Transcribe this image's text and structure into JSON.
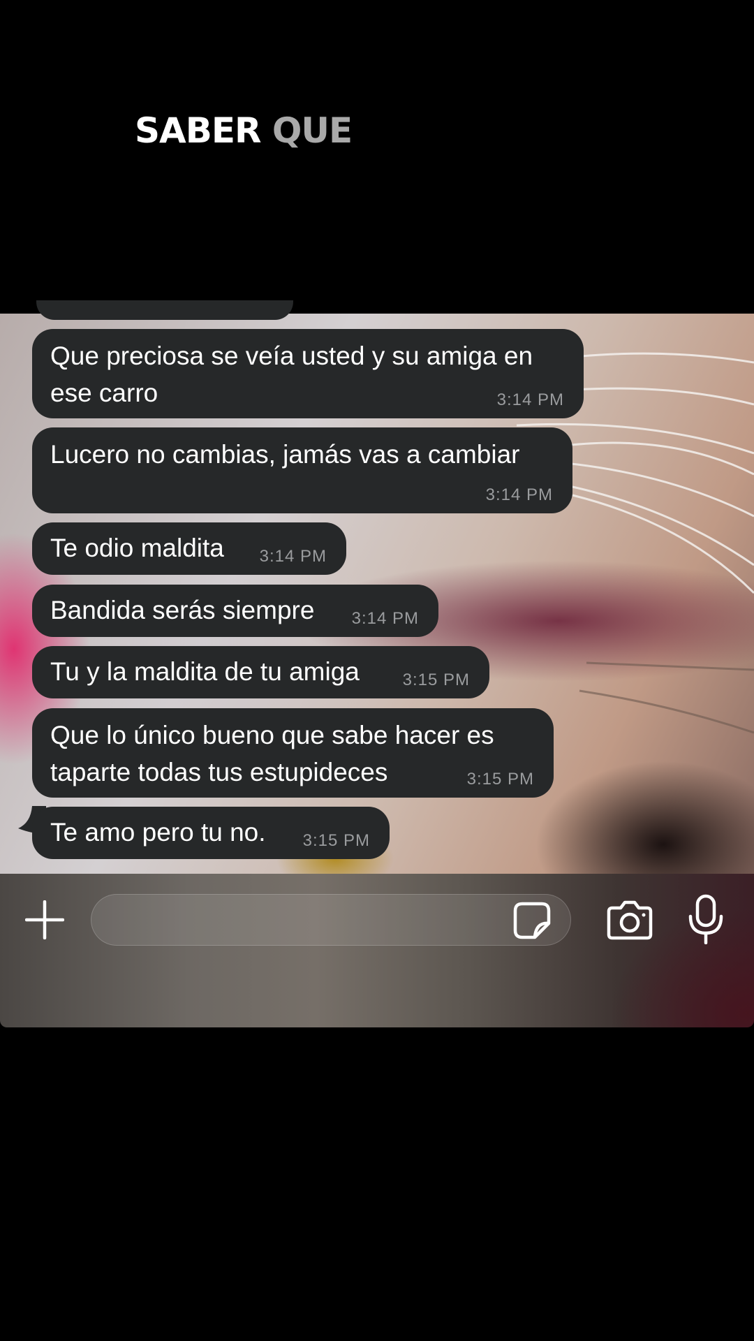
{
  "caption": {
    "part1": "SABER",
    "part2": "QUE"
  },
  "messages": [
    {
      "text": "Que preciosa se veía usted y su amiga en ese carro",
      "time": "3:14 PM"
    },
    {
      "text": "Lucero no cambias, jamás vas a cambiar",
      "time": "3:14 PM"
    },
    {
      "text": "Te odio maldita",
      "time": "3:14 PM"
    },
    {
      "text": "Bandida serás siempre",
      "time": "3:14 PM"
    },
    {
      "text": "Tu y la maldita de tu amiga",
      "time": "3:15 PM"
    },
    {
      "text": "Que lo único bueno que sabe hacer es taparte todas tus estupideces",
      "time": "3:15 PM"
    },
    {
      "text": "Te amo pero tu no.",
      "time": "3:15 PM"
    }
  ],
  "composer": {
    "icons": [
      "plus-icon",
      "sticker-icon",
      "camera-icon",
      "microphone-icon"
    ]
  },
  "colors": {
    "bubble": "#262829",
    "bubble_text": "#ffffff",
    "timestamp": "#9a9c9e",
    "background": "#000000",
    "caption_highlight": "#a9a9a9"
  }
}
